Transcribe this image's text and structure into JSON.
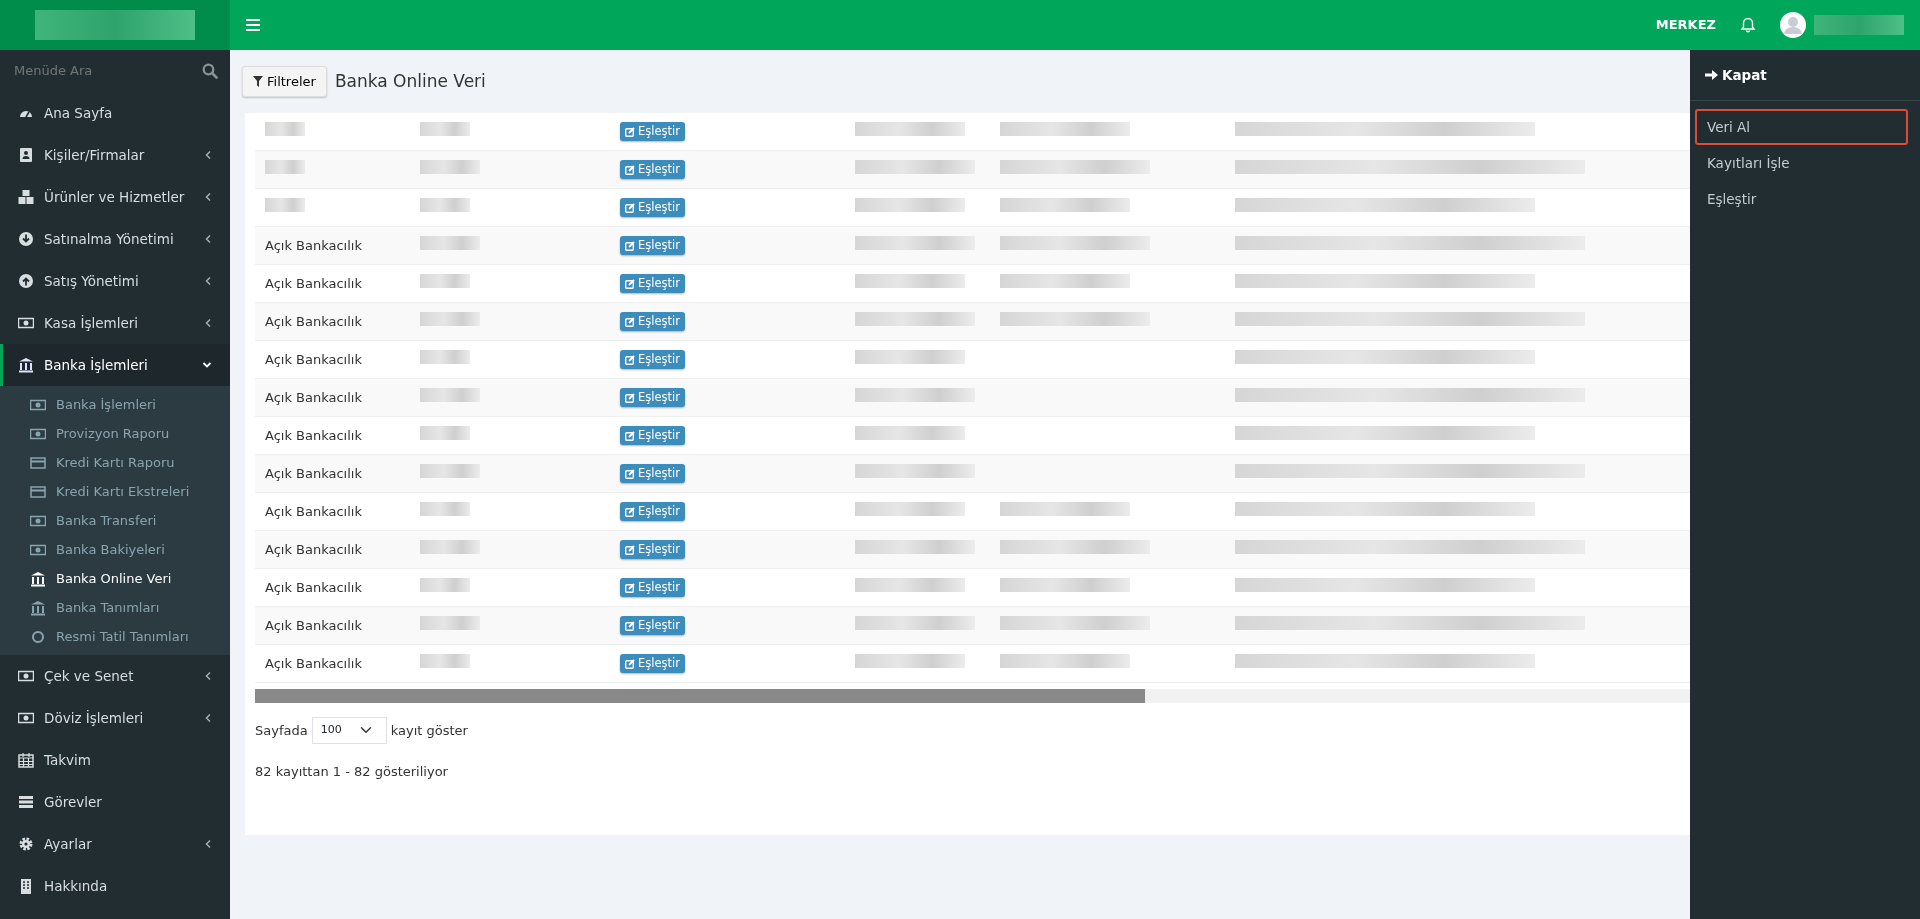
{
  "topbar": {
    "branch": "MERKEZ"
  },
  "sidebar": {
    "search": {
      "placeholder": "Menüde Ara"
    },
    "items": [
      {
        "label": "Ana Sayfa",
        "kind": "link",
        "selected": false
      },
      {
        "label": "Kişiler/Firmalar",
        "kind": "menu",
        "expanded": false,
        "selected": false
      },
      {
        "label": "Ürünler ve Hizmetler",
        "kind": "menu",
        "expanded": false,
        "selected": false
      },
      {
        "label": "Satınalma Yönetimi",
        "kind": "menu",
        "expanded": false,
        "selected": false
      },
      {
        "label": "Satış Yönetimi",
        "kind": "menu",
        "expanded": false,
        "selected": false
      },
      {
        "label": "Kasa İşlemleri",
        "kind": "menu",
        "expanded": false,
        "selected": false
      },
      {
        "label": "Banka İşlemleri",
        "kind": "menu",
        "expanded": true,
        "selected": true,
        "children": [
          {
            "label": "Banka İşlemleri",
            "selected": false
          },
          {
            "label": "Provizyon Raporu",
            "selected": false
          },
          {
            "label": "Kredi Kartı Raporu",
            "selected": false
          },
          {
            "label": "Kredi Kartı Ekstreleri",
            "selected": false
          },
          {
            "label": "Banka Transferi",
            "selected": false
          },
          {
            "label": "Banka Bakiyeleri",
            "selected": false
          },
          {
            "label": "Banka Online Veri",
            "selected": true
          },
          {
            "label": "Banka Tanımları",
            "selected": false
          },
          {
            "label": "Resmi Tatil Tanımları",
            "selected": false
          }
        ]
      },
      {
        "label": "Çek ve Senet",
        "kind": "menu",
        "expanded": false,
        "selected": false
      },
      {
        "label": "Döviz İşlemleri",
        "kind": "menu",
        "expanded": false,
        "selected": false
      },
      {
        "label": "Takvim",
        "kind": "link",
        "selected": false
      },
      {
        "label": "Görevler",
        "kind": "link",
        "selected": false
      },
      {
        "label": "Ayarlar",
        "kind": "menu",
        "expanded": false,
        "selected": false
      },
      {
        "label": "Hakkında",
        "kind": "link",
        "selected": false
      }
    ]
  },
  "page": {
    "filter_button": "Filtreler",
    "title": "Banka Online Veri"
  },
  "table": {
    "rows": [
      {
        "action": "Eşleştir"
      },
      {
        "action": "Eşleştir"
      },
      {
        "action": "Eşleştir"
      },
      {
        "source": "Açık Bankacılık",
        "action": "Eşleştir"
      },
      {
        "source": "Açık Bankacılık",
        "action": "Eşleştir"
      },
      {
        "source": "Açık Bankacılık",
        "action": "Eşleştir"
      },
      {
        "source": "Açık Bankacılık",
        "action": "Eşleştir"
      },
      {
        "source": "Açık Bankacılık",
        "action": "Eşleştir"
      },
      {
        "source": "Açık Bankacılık",
        "action": "Eşleştir"
      },
      {
        "source": "Açık Bankacılık",
        "action": "Eşleştir"
      },
      {
        "source": "Açık Bankacılık",
        "action": "Eşleştir"
      },
      {
        "source": "Açık Bankacılık",
        "action": "Eşleştir"
      },
      {
        "source": "Açık Bankacılık",
        "action": "Eşleştir"
      },
      {
        "source": "Açık Bankacılık",
        "action": "Eşleştir"
      },
      {
        "source": "Açık Bankacılık",
        "action": "Eşleştir"
      }
    ]
  },
  "pagination": {
    "prefix": "Sayfada",
    "page_size": "100",
    "suffix": "kayıt göster",
    "info": "82 kayıttan 1 - 82 gösteriliyor"
  },
  "side_panel": {
    "close_button": "Kapat",
    "items": [
      {
        "label": "Veri Al",
        "selected": true
      },
      {
        "label": "Kayıtları İşle",
        "selected": false
      },
      {
        "label": "Eşleştir",
        "selected": false
      }
    ]
  }
}
